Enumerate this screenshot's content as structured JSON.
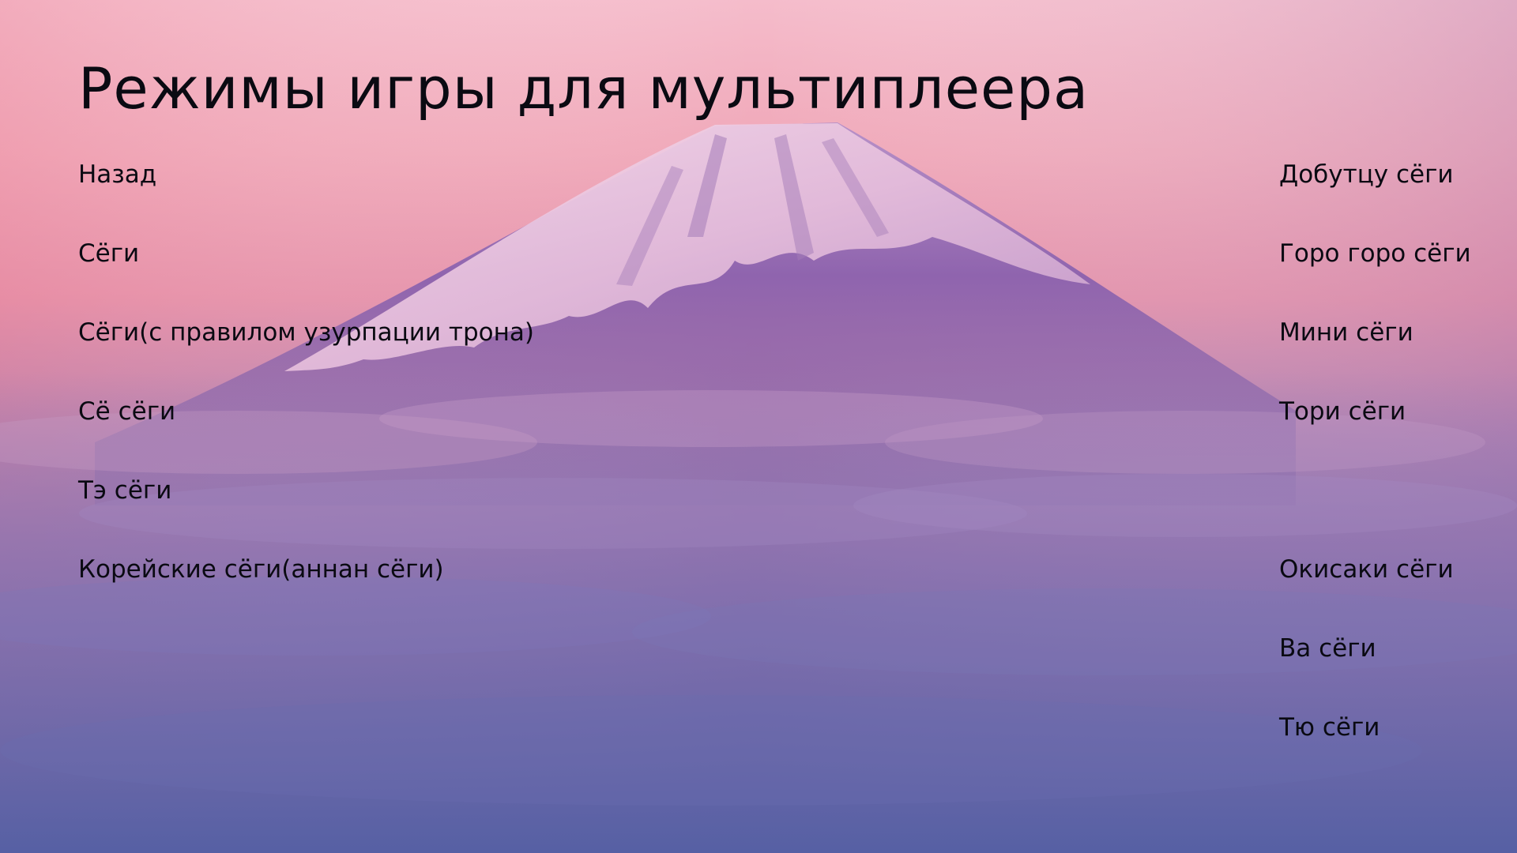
{
  "screen": {
    "title": "Режимы игры для мультиплеера"
  },
  "menu_left": [
    "Назад",
    "Сёги",
    "Сёги(с правилом узурпации трона)",
    "Сё сёги",
    "Тэ сёги",
    "Корейские сёги(аннан сёги)"
  ],
  "menu_right": [
    "Добутцу сёги",
    "Горо горо сёги",
    "Мини сёги",
    "Тори сёги",
    "",
    "Окисаки сёги",
    "Ва сёги",
    "Тю сёги"
  ],
  "background": {
    "image": "mount-fuji-at-dusk",
    "sky_top": "#f4b9c6",
    "sky_mid": "#e28aa4",
    "haze": "#8a6aa8",
    "bottom": "#4f5aa0",
    "snow": "#f3d4e6",
    "mountain": "#8a5fa8"
  }
}
